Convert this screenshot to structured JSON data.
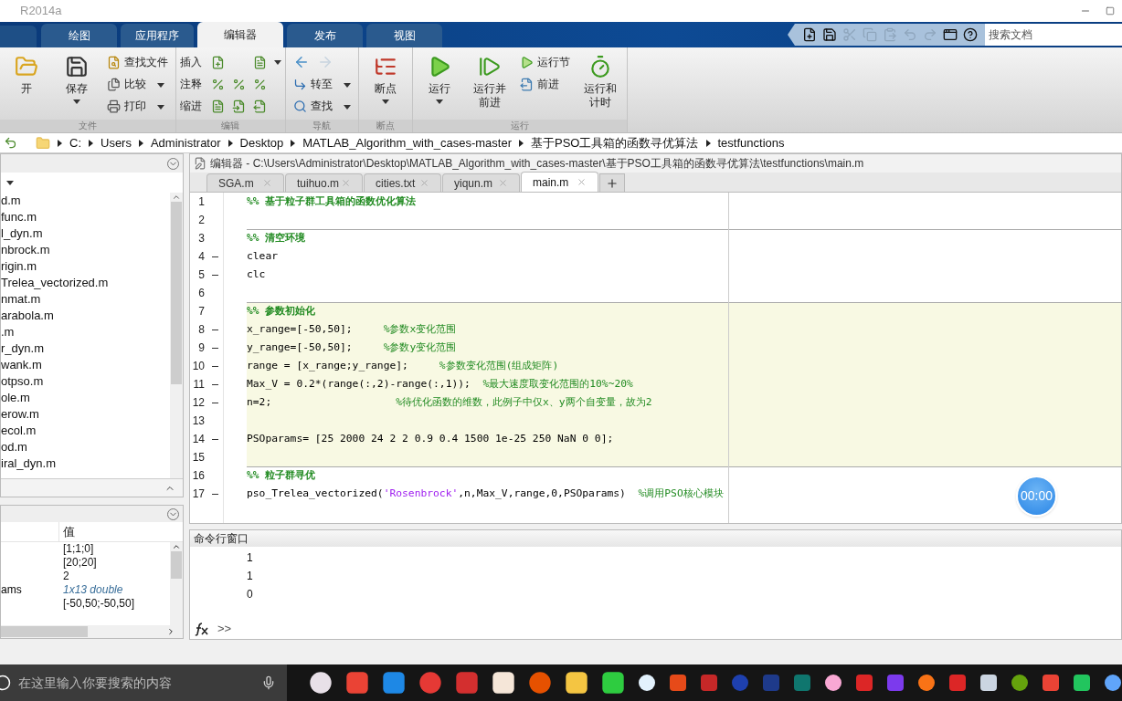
{
  "window": {
    "title": "R2014a"
  },
  "ribbon_tabs": [
    {
      "label": "绘图",
      "selected": false
    },
    {
      "label": "应用程序",
      "selected": false
    },
    {
      "label": "编辑器",
      "selected": true
    },
    {
      "label": "发布",
      "selected": false
    },
    {
      "label": "视图",
      "selected": false
    }
  ],
  "quick_access": [
    {
      "disabled": false
    },
    {
      "disabled": false
    },
    {
      "disabled": true
    },
    {
      "disabled": true
    },
    {
      "disabled": true
    },
    {
      "disabled": true
    },
    {
      "disabled": true
    },
    {
      "disabled": false
    },
    {
      "disabled": false
    }
  ],
  "search": {
    "placeholder": "搜索文档"
  },
  "ribbon_groups": [
    {
      "label": "文件",
      "columns": [
        [
          {
            "kind": "large",
            "label": "开",
            "dropdown": false
          }
        ],
        [
          {
            "kind": "large",
            "label": "保存",
            "dropdown": true
          }
        ],
        [
          {
            "kind": "small",
            "label": "查找文件",
            "dropdown": false
          },
          {
            "kind": "small",
            "label": "比较",
            "dropdown": true
          },
          {
            "kind": "small",
            "label": "打印",
            "dropdown": true
          }
        ]
      ]
    },
    {
      "label": "编辑",
      "columns": [
        [
          {
            "kind": "tool-row",
            "label": "插入",
            "dropdown": true
          },
          {
            "kind": "tool-row",
            "label": "注释"
          },
          {
            "kind": "tool-row",
            "label": "缩进"
          }
        ]
      ]
    },
    {
      "label": "导航",
      "columns": [
        [
          {
            "kind": "arrows",
            "back_disabled": false,
            "forward_disabled": true
          },
          {
            "kind": "small",
            "label": "转至",
            "dropdown": true
          },
          {
            "kind": "small",
            "label": "查找",
            "dropdown": true
          }
        ]
      ]
    },
    {
      "label": "断点",
      "columns": [
        [
          {
            "kind": "large",
            "label": "断点",
            "dropdown": true
          }
        ]
      ]
    },
    {
      "label": "运行",
      "columns": [
        [
          {
            "kind": "large",
            "label": "运行",
            "dropdown": true
          }
        ],
        [
          {
            "kind": "large",
            "label": "运行并前进",
            "dropdown": false
          }
        ],
        [
          {
            "kind": "small",
            "label": "运行节",
            "dropdown": false
          },
          {
            "kind": "small",
            "label": "前进",
            "dropdown": false
          }
        ],
        [
          {
            "kind": "large",
            "label": "运行和计时",
            "dropdown": false
          }
        ]
      ]
    }
  ],
  "breadcrumb": [
    "C:",
    "Users",
    "Administrator",
    "Desktop",
    "MATLAB_Algorithm_with_cases-master",
    "基于PSO工具箱的函数寻优算法",
    "testfunctions"
  ],
  "current_folder": {
    "files": [
      "d.m",
      "func.m",
      "l_dyn.m",
      "nbrock.m",
      "rigin.m",
      "Trelea_vectorized.m",
      "nmat.m",
      "arabola.m",
      ".m",
      "r_dyn.m",
      "wank.m",
      "otpso.m",
      "ole.m",
      "erow.m",
      "ecol.m",
      "od.m",
      "iral_dyn.m"
    ]
  },
  "workspace": {
    "value_header": "值",
    "rows": [
      {
        "value": "[1;1;0]",
        "kind": "literal"
      },
      {
        "value": "[20;20]",
        "kind": "literal"
      },
      {
        "value": "2",
        "kind": "literal"
      },
      {
        "name": "ams",
        "value": "1x13 double",
        "kind": "summary"
      },
      {
        "value": "[-50,50;-50,50]",
        "kind": "literal"
      }
    ]
  },
  "editor": {
    "title": "编辑器 - C:\\Users\\Administrator\\Desktop\\MATLAB_Algorithm_with_cases-master\\基于PSO工具箱的函数寻优算法\\testfunctions\\main.m",
    "tabs": [
      {
        "label": "SGA.m",
        "selected": false
      },
      {
        "label": "tuihuo.m",
        "selected": false
      },
      {
        "label": "cities.txt",
        "selected": false
      },
      {
        "label": "yiqun.m",
        "selected": false
      },
      {
        "label": "main.m",
        "selected": true
      }
    ],
    "lines": [
      {
        "number": "1",
        "segments": [
          {
            "kind": "section",
            "text": "%% 基于粒子群工具箱的函数优化算法"
          }
        ]
      },
      {
        "number": "2"
      },
      {
        "number": "3",
        "highlighted": false,
        "section_start": true,
        "segments": [
          {
            "kind": "section",
            "text": "%% 清空环境"
          }
        ]
      },
      {
        "number": "4",
        "executable": true,
        "segments": [
          {
            "kind": "code",
            "text": "clear"
          }
        ]
      },
      {
        "number": "5",
        "executable": true,
        "segments": [
          {
            "kind": "code",
            "text": "clc"
          }
        ]
      },
      {
        "number": "6"
      },
      {
        "number": "7",
        "highlighted": true,
        "section_start": true,
        "segments": [
          {
            "kind": "section",
            "text": "%% 参数初始化"
          }
        ]
      },
      {
        "number": "8",
        "executable": true,
        "highlighted": true,
        "section_start": false,
        "segments": [
          {
            "kind": "code",
            "text": "x_range=[-50,50];     "
          },
          {
            "kind": "comment",
            "text": "%参数x变化范围"
          }
        ]
      },
      {
        "number": "9",
        "executable": true,
        "highlighted": true,
        "section_start": false,
        "segments": [
          {
            "kind": "code",
            "text": "y_range=[-50,50];     "
          },
          {
            "kind": "comment",
            "text": "%参数y变化范围"
          }
        ]
      },
      {
        "number": "10",
        "executable": true,
        "highlighted": true,
        "section_start": false,
        "segments": [
          {
            "kind": "code",
            "text": "range = [x_range;y_range];     "
          },
          {
            "kind": "comment",
            "text": "%参数变化范围(组成矩阵)"
          }
        ]
      },
      {
        "number": "11",
        "executable": true,
        "highlighted": true,
        "section_start": false,
        "segments": [
          {
            "kind": "code",
            "text": "Max_V = 0.2*(range(:,2)-range(:,1));  "
          },
          {
            "kind": "comment",
            "text": "%最大速度取变化范围的10%~20%"
          }
        ]
      },
      {
        "number": "12",
        "executable": true,
        "highlighted": true,
        "section_start": false,
        "segments": [
          {
            "kind": "code",
            "text": "n=2;                    "
          },
          {
            "kind": "comment",
            "text": "%待优化函数的维数，此例子中仅x、y两个自变量，故为2"
          }
        ]
      },
      {
        "number": "13",
        "highlighted": true,
        "section_start": false
      },
      {
        "number": "14",
        "executable": true,
        "highlighted": true,
        "section_start": false,
        "segments": [
          {
            "kind": "code",
            "text": "PSOparams= [25 2000 24 2 2 0.9 0.4 1500 1e-25 250 NaN 0 0];"
          }
        ]
      },
      {
        "number": "15",
        "highlighted": true,
        "section_start": false
      },
      {
        "number": "16",
        "highlighted": false,
        "section_start": true,
        "segments": [
          {
            "kind": "section",
            "text": "%% 粒子群寻优"
          }
        ]
      },
      {
        "number": "17",
        "executable": true,
        "segments": [
          {
            "kind": "code",
            "text": "pso_Trelea_vectorized("
          },
          {
            "kind": "string",
            "text": "'Rosenbrock'"
          },
          {
            "kind": "code",
            "text": ",n,Max_V,range,0,PSOparams)  "
          },
          {
            "kind": "comment",
            "text": "%调用PSO核心模块"
          }
        ]
      }
    ]
  },
  "command_window": {
    "title": "命令行窗口",
    "output": [
      "1",
      "1",
      "0"
    ],
    "prompt": ">>"
  },
  "timer": {
    "text": "00:00"
  },
  "taskbar": {
    "search_placeholder": "在这里输入你要搜索的内容"
  }
}
